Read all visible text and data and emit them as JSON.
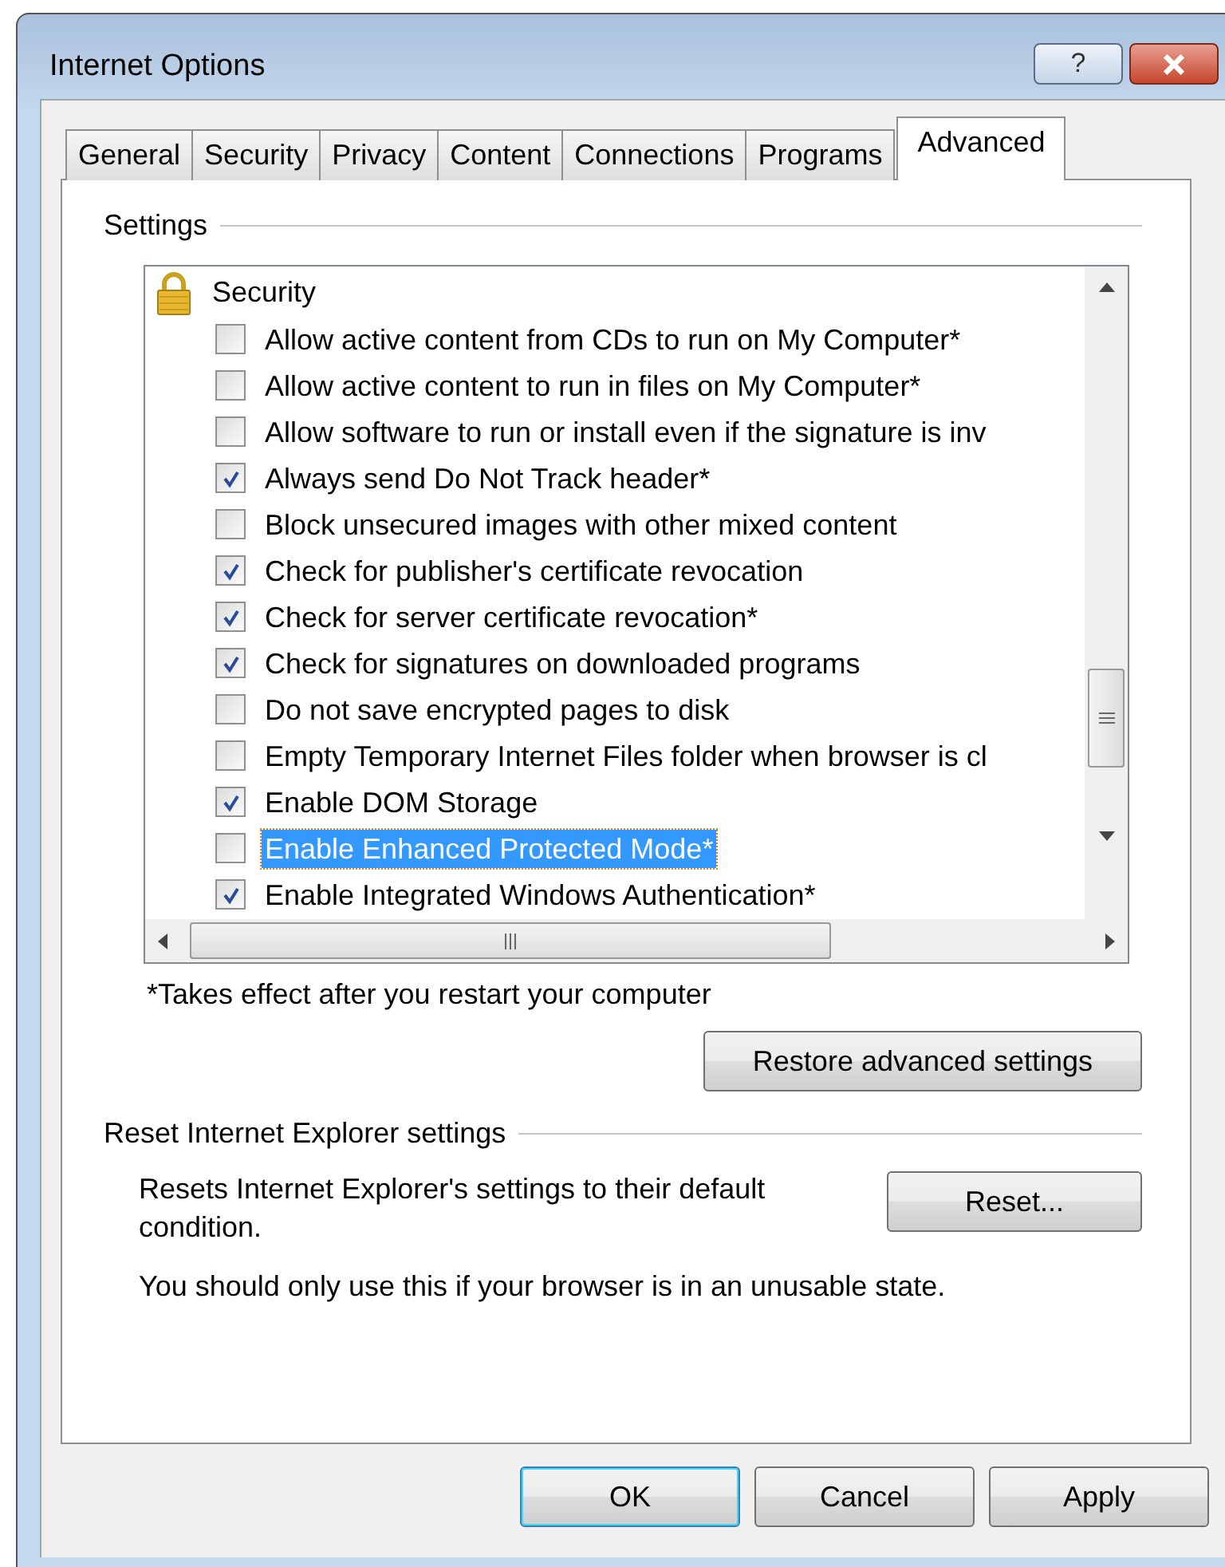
{
  "window": {
    "title": "Internet Options"
  },
  "title_buttons": [
    {
      "kind": "help",
      "label": "?"
    },
    {
      "kind": "close"
    }
  ],
  "tabs": [
    {
      "label": "General",
      "selected": false
    },
    {
      "label": "Security",
      "selected": false
    },
    {
      "label": "Privacy",
      "selected": false
    },
    {
      "label": "Content",
      "selected": false
    },
    {
      "label": "Connections",
      "selected": false
    },
    {
      "label": "Programs",
      "selected": false
    },
    {
      "label": "Advanced",
      "selected": true
    }
  ],
  "settings": {
    "legend": "Settings",
    "tree": [
      {
        "label": "Security",
        "children": [
          {
            "label": "Allow active content from CDs to run on My Computer*",
            "checked": false,
            "selected": false
          },
          {
            "label": "Allow active content to run in files on My Computer*",
            "checked": false,
            "selected": false
          },
          {
            "label": "Allow software to run or install even if the signature is inv",
            "checked": false,
            "selected": false
          },
          {
            "label": "Always send Do Not Track header*",
            "checked": true,
            "selected": false
          },
          {
            "label": "Block unsecured images with other mixed content",
            "checked": false,
            "selected": false
          },
          {
            "label": "Check for publisher's certificate revocation",
            "checked": true,
            "selected": false
          },
          {
            "label": "Check for server certificate revocation*",
            "checked": true,
            "selected": false
          },
          {
            "label": "Check for signatures on downloaded programs",
            "checked": true,
            "selected": false
          },
          {
            "label": "Do not save encrypted pages to disk",
            "checked": false,
            "selected": false
          },
          {
            "label": "Empty Temporary Internet Files folder when browser is cl",
            "checked": false,
            "selected": false
          },
          {
            "label": "Enable DOM Storage",
            "checked": true,
            "selected": false
          },
          {
            "label": "Enable Enhanced Protected Mode*",
            "checked": false,
            "selected": true
          },
          {
            "label": "Enable Integrated Windows Authentication*",
            "checked": true,
            "selected": false
          }
        ]
      }
    ],
    "note": "*Takes effect after you restart your computer",
    "restore_button": "Restore advanced settings"
  },
  "reset": {
    "legend": "Reset Internet Explorer settings",
    "description": "Resets Internet Explorer's settings to their default condition.",
    "button": "Reset...",
    "warning": "You should only use this if your browser is in an unusable state."
  },
  "buttons": [
    {
      "label": "OK",
      "default": true
    },
    {
      "label": "Cancel",
      "default": false
    },
    {
      "label": "Apply",
      "default": false
    }
  ]
}
